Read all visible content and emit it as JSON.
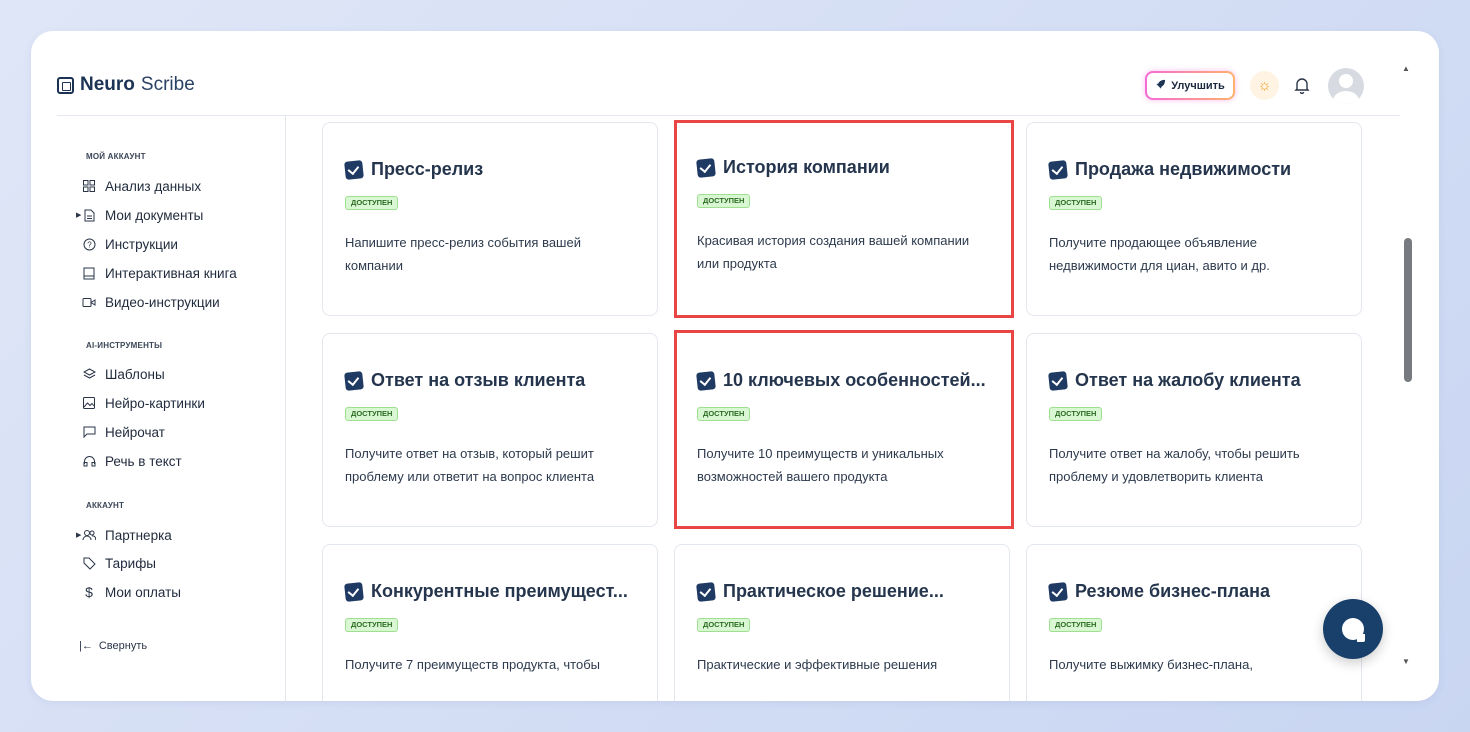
{
  "app": {
    "logo_bold": "Neuro",
    "logo_light": "Scribe"
  },
  "header": {
    "upgrade_label": "Улучшить",
    "icons": [
      "rocket-icon",
      "sun-icon",
      "bell-icon",
      "avatar"
    ]
  },
  "sidebar": {
    "sections": [
      {
        "title": "МОЙ АККАУНТ",
        "items": [
          {
            "label": "Анализ данных",
            "icon": "grid-icon"
          },
          {
            "label": "Мои документы",
            "icon": "document-icon",
            "expandable": true
          },
          {
            "label": "Инструкции",
            "icon": "help-icon"
          },
          {
            "label": "Интерактивная книга",
            "icon": "book-icon"
          },
          {
            "label": "Видео-инструкции",
            "icon": "video-icon"
          }
        ]
      },
      {
        "title": "AI-ИНСТРУМЕНТЫ",
        "items": [
          {
            "label": "Шаблоны",
            "icon": "layers-icon"
          },
          {
            "label": "Нейро-картинки",
            "icon": "image-icon"
          },
          {
            "label": "Нейрочат",
            "icon": "chat-icon"
          },
          {
            "label": "Речь в текст",
            "icon": "headphones-icon"
          }
        ]
      },
      {
        "title": "АККАУНТ",
        "items": [
          {
            "label": "Партнерка",
            "icon": "users-icon",
            "expandable": true
          },
          {
            "label": "Тарифы",
            "icon": "tag-icon"
          },
          {
            "label": "Мои оплаты",
            "icon": "dollar-icon"
          }
        ]
      }
    ],
    "collapse_label": "Свернуть"
  },
  "cards": [
    {
      "title": "Пресс-релиз",
      "badge": "ДОСТУПЕН",
      "desc": "Напишите пресс-релиз события вашей компании",
      "highlighted": false
    },
    {
      "title": "История компании",
      "badge": "ДОСТУПЕН",
      "desc": "Красивая история создания вашей компании или продукта",
      "highlighted": true
    },
    {
      "title": "Продажа недвижимости",
      "badge": "ДОСТУПЕН",
      "desc": "Получите продающее объявление недвижимости для циан, авито и др.",
      "highlighted": false
    },
    {
      "title": "Ответ на отзыв клиента",
      "badge": "ДОСТУПЕН",
      "desc": "Получите ответ на отзыв, который решит проблему или ответит на вопрос клиента",
      "highlighted": false
    },
    {
      "title": "10 ключевых особенностей...",
      "badge": "ДОСТУПЕН",
      "desc": "Получите 10 преимуществ и уникальных возможностей вашего продукта",
      "highlighted": true
    },
    {
      "title": "Ответ на жалобу клиента",
      "badge": "ДОСТУПЕН",
      "desc": "Получите ответ на жалобу, чтобы решить проблему и удовлетворить клиента",
      "highlighted": false
    },
    {
      "title": "Конкурентные преимущест...",
      "badge": "ДОСТУПЕН",
      "desc": "Получите 7 преимуществ продукта, чтобы",
      "highlighted": false
    },
    {
      "title": "Практическое решение...",
      "badge": "ДОСТУПЕН",
      "desc": "Практические и эффективные решения",
      "highlighted": false
    },
    {
      "title": "Резюме бизнес-плана",
      "badge": "ДОСТУПЕН",
      "desc": "Получите выжимку бизнес-плана,",
      "highlighted": false
    }
  ],
  "colors": {
    "highlight": "#e84545",
    "badge_bg": "#d9f7d3",
    "badge_text": "#2c6b22",
    "check_bg": "#1f3a63",
    "chat_button": "#18406b"
  }
}
